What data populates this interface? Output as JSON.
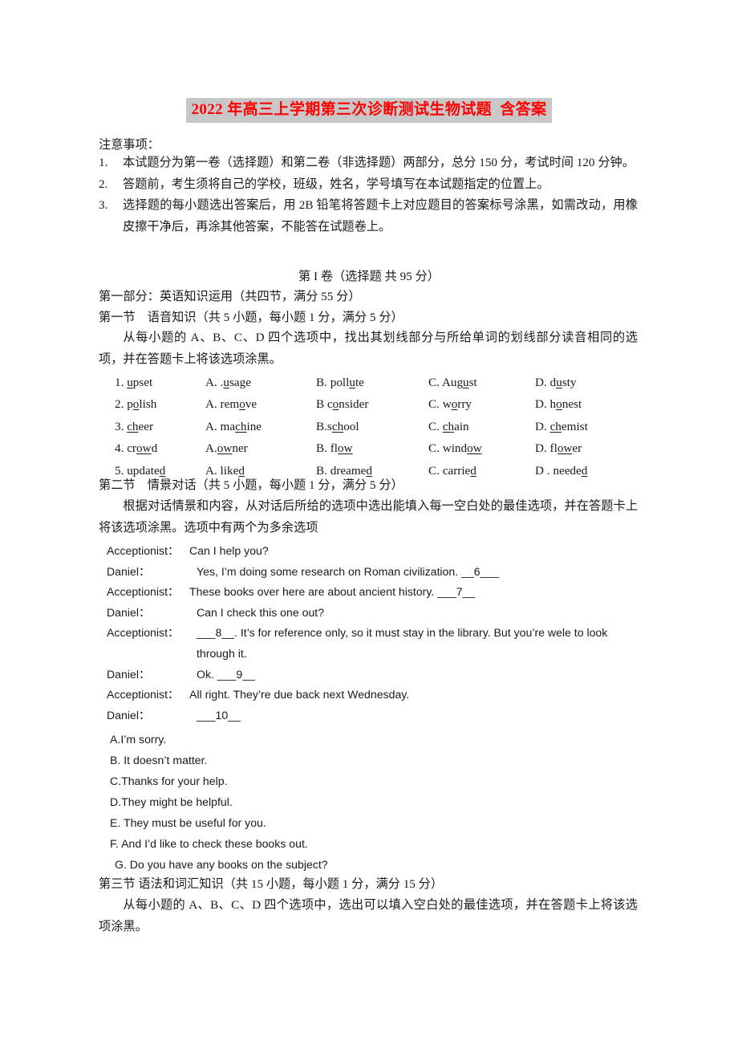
{
  "document": {
    "title": "2022 年高三上学期第三次诊断测试生物试题  含答案",
    "title_color": "#ff0000",
    "title_highlight_color": "#c8c8c8"
  },
  "notes": {
    "label": "注意事项：",
    "items": [
      {
        "num": "1.",
        "text": "本试题分为第一卷（选择题）和第二卷（非选择题）两部分，总分 150 分，考试时间 120 分钟。"
      },
      {
        "num": "2.",
        "text": "答题前，考生须将自己的学校，班级，姓名，学号填写在本试题指定的位置上。"
      },
      {
        "num": "3.",
        "text": "选择题的每小题选出答案后，用 2B 铅笔将答题卡上对应题目的答案标号涂黑，如需改动，用橡皮擦干净后，再涂其他答案，不能答在试题卷上。"
      }
    ]
  },
  "paper": {
    "volume_heading": "第 I 卷（选择题 共 95 分）",
    "part_one": "第一部分：英语知识运用（共四节，满分 55 分）",
    "section_one_heading": "第一节    语音知识（共 5 小题，每小题 1 分，满分 5 分）",
    "section_one_instruction": "从每小题的 A、B、C、D 四个选项中，找出其划线部分与所给单词的划线部分读音相同的选项，并在答题卡上将该选项涂黑。",
    "section_two_heading": "第二节    情景对话（共 5 小题，每小题 1 分，满分 5 分）",
    "section_two_instruction": "根据对话情景和内容，从对话后所给的选项中选出能填入每一空白处的最佳选项，并在答题卡上将该选项涂黑。选项中有两个为多余选项",
    "section_three_heading": "第三节 语法和词汇知识（共 15 小题，每小题 1 分，满分 15 分）",
    "section_three_instruction": "从每小题的 A、B、C、D 四个选项中，选出可以填入空白处的最佳选项，并在答题卡上将该选项涂黑。"
  },
  "phonetics": {
    "rows": [
      {
        "stem": {
          "num": "1.",
          "pre": "",
          "under": "u",
          "post": "pset"
        },
        "a": {
          "label": "A.",
          "pre": " .",
          "under": "u",
          "post": "sage"
        },
        "b": {
          "label": "B.",
          "pre": " poll",
          "under": "u",
          "post": "te"
        },
        "c": {
          "label": "C.",
          "pre": " Aug",
          "under": "u",
          "post": "st"
        },
        "d": {
          "label": "D.",
          "pre": " d",
          "under": "u",
          "post": "sty"
        }
      },
      {
        "stem": {
          "num": "2.",
          "pre": "p",
          "under": "o",
          "post": "lish"
        },
        "a": {
          "label": "A.",
          "pre": " rem",
          "under": "o",
          "post": "ve"
        },
        "b": {
          "label": "B",
          "pre": " c",
          "under": "o",
          "post": "nsider"
        },
        "c": {
          "label": "C.",
          "pre": " w",
          "under": "o",
          "post": "rry"
        },
        "d": {
          "label": "D.",
          "pre": " h",
          "under": "o",
          "post": "nest"
        }
      },
      {
        "stem": {
          "num": "3.",
          "pre": "",
          "under": "ch",
          "post": "eer"
        },
        "a": {
          "label": "A.",
          "pre": " ma",
          "under": "ch",
          "post": "ine"
        },
        "b": {
          "label": "B.",
          "pre": "s",
          "under": "ch",
          "post": "ool"
        },
        "c": {
          "label": "C.",
          "pre": " ",
          "under": "ch",
          "post": "ain"
        },
        "d": {
          "label": "D.",
          "pre": " ",
          "under": "ch",
          "post": "emist"
        }
      },
      {
        "stem": {
          "num": "4.",
          "pre": "cr",
          "under": "ow",
          "post": "d"
        },
        "a": {
          "label": "A.",
          "pre": "",
          "under": "ow",
          "post": "ner"
        },
        "b": {
          "label": "B.",
          "pre": " fl",
          "under": "ow",
          "post": ""
        },
        "c": {
          "label": "C.",
          "pre": " wind",
          "under": "ow",
          "post": ""
        },
        "d": {
          "label": "D.",
          "pre": " fl",
          "under": "ow",
          "post": "er"
        }
      },
      {
        "stem": {
          "num": "5.",
          "pre": "update",
          "under": "d",
          "post": ""
        },
        "a": {
          "label": "A.",
          "pre": " like",
          "under": "d",
          "post": ""
        },
        "b": {
          "label": "B.",
          "pre": " dreame",
          "under": "d",
          "post": ""
        },
        "c": {
          "label": "C.",
          "pre": " carrie",
          "under": "d",
          "post": ""
        },
        "d": {
          "label": "D .",
          "pre": " neede",
          "under": "d",
          "post": ""
        }
      }
    ]
  },
  "dialogue": {
    "lines": [
      {
        "speaker": "Acceptionist：",
        "text": "Can I help you?",
        "indent": false
      },
      {
        "speaker": "Daniel：",
        "text": "Yes, I’m doing some research on Roman civilization. __6___",
        "indent": true
      },
      {
        "speaker": "Acceptionist：",
        "text": "These books over here are about ancient history. ___7__",
        "indent": false
      },
      {
        "speaker": "Daniel：",
        "text": "Can I check this one out?",
        "indent": true
      },
      {
        "speaker": "Acceptionist：",
        "text": "___8__. It’s for reference only, so it must stay in the library. But you’re wele to look",
        "indent": true
      },
      {
        "speaker": "",
        "text": "through it.",
        "indent": true
      },
      {
        "speaker": "Daniel：",
        "text": "Ok. ___9__",
        "indent": true
      },
      {
        "speaker": "Acceptionist：",
        "text": "All right. They’re due back next Wednesday.",
        "indent": false
      },
      {
        "speaker": "Daniel：",
        "text": "___10__",
        "indent": true
      }
    ],
    "options": [
      "A.I’m sorry.",
      "B. It doesn’t matter.",
      "C.Thanks for your help.",
      "D.They might be helpful.",
      "E. They must be useful for you.",
      "F. And I’d like to check these books out.",
      "G. Do you have any books on the subject?"
    ]
  }
}
